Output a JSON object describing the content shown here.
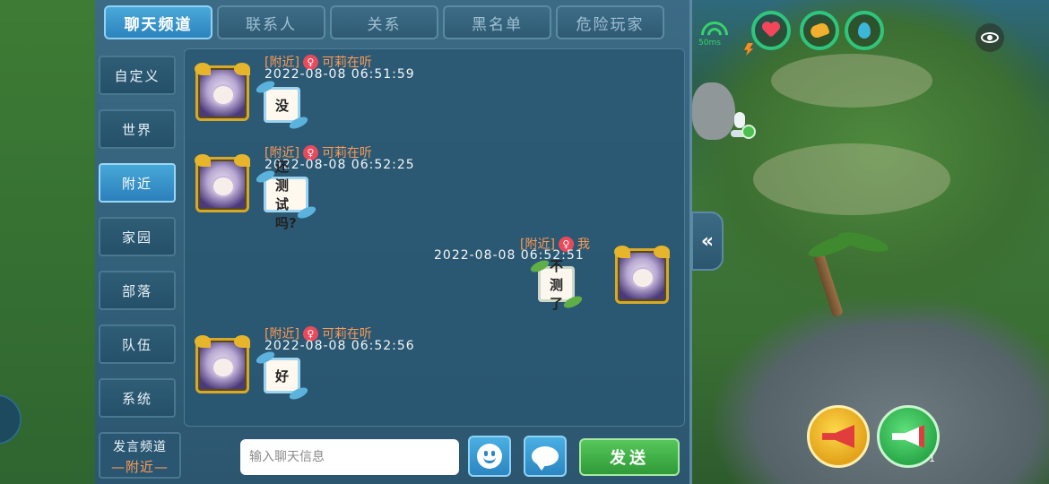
{
  "tabs": [
    {
      "label": "聊天频道",
      "active": true
    },
    {
      "label": "联系人",
      "active": false
    },
    {
      "label": "关系",
      "active": false
    },
    {
      "label": "黑名单",
      "active": false
    },
    {
      "label": "危险玩家",
      "active": false
    }
  ],
  "channels": [
    {
      "label": "自定义",
      "active": false
    },
    {
      "label": "世界",
      "active": false
    },
    {
      "label": "附近",
      "active": true
    },
    {
      "label": "家园",
      "active": false
    },
    {
      "label": "部落",
      "active": false
    },
    {
      "label": "队伍",
      "active": false
    },
    {
      "label": "系统",
      "active": false
    }
  ],
  "messages": [
    {
      "channel": "[附近]",
      "sender": "可莉在听",
      "time": "2022-08-08   06:51:59",
      "text": "没",
      "mine": false
    },
    {
      "channel": "[附近]",
      "sender": "可莉在听",
      "time": "2022-08-08   06:52:25",
      "text": "还测试吗?",
      "mine": false
    },
    {
      "channel": "[附近]",
      "sender": "我",
      "time": "2022-08-08   06:52:51",
      "text": "不测了",
      "mine": true
    },
    {
      "channel": "[附近]",
      "sender": "可莉在听",
      "time": "2022-08-08   06:52:56",
      "text": "好",
      "mine": false
    }
  ],
  "gender_symbol": "♀",
  "bottom": {
    "send_channel_label": "发言频道",
    "send_channel_value": "—附近—",
    "input_placeholder": "输入聊天信息",
    "send_label": "发送"
  },
  "hud": {
    "ping": "50ms",
    "collapse_symbol": "«",
    "horn_count": "1"
  },
  "colors": {
    "accent": "#2c83be",
    "send_green": "#2f9a39",
    "channel_orange": "#ff9a55",
    "status_green": "#2fc57d"
  }
}
